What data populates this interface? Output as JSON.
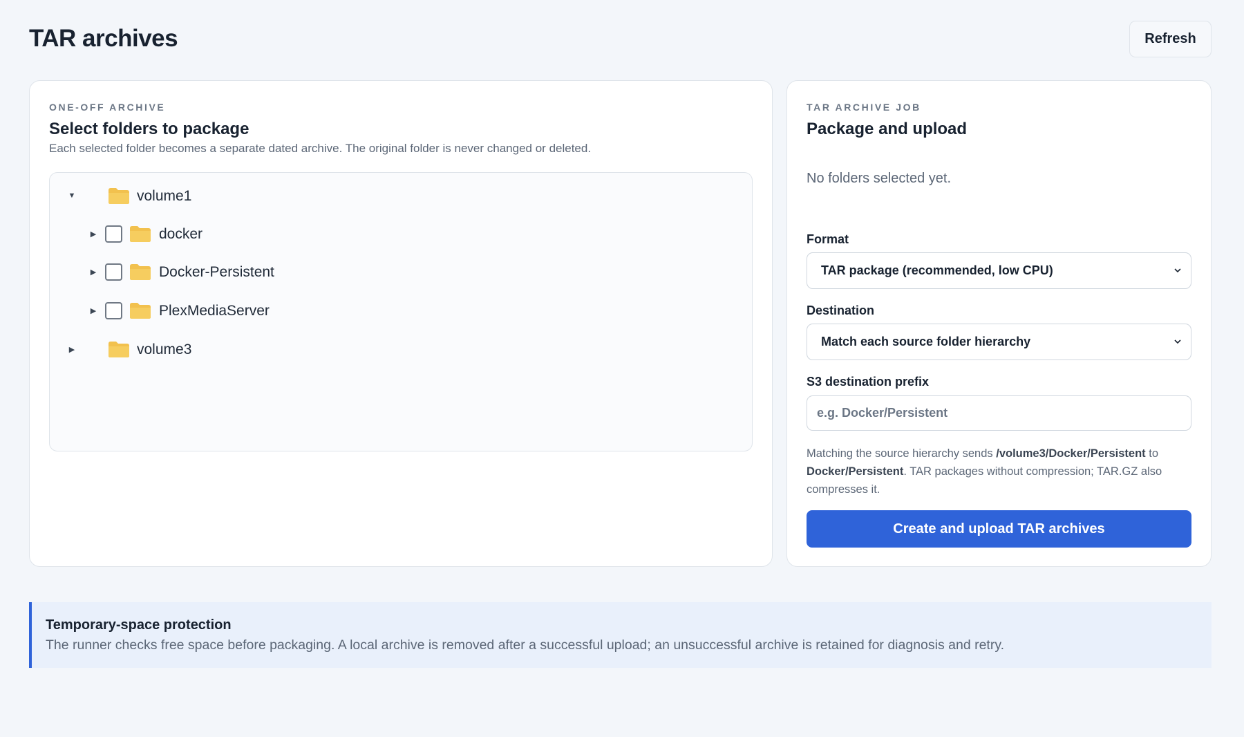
{
  "header": {
    "title": "TAR archives",
    "refresh_label": "Refresh"
  },
  "left_card": {
    "eyebrow": "ONE-OFF ARCHIVE",
    "title": "Select folders to package",
    "description": "Each selected folder becomes a separate dated archive. The original folder is never changed or deleted.",
    "tree": [
      {
        "label": "volume1",
        "expanded": true,
        "selectable": false
      },
      {
        "label": "docker",
        "expanded": false,
        "selectable": true,
        "checked": false
      },
      {
        "label": "Docker-Persistent",
        "expanded": false,
        "selectable": true,
        "checked": false
      },
      {
        "label": "PlexMediaServer",
        "expanded": false,
        "selectable": true,
        "checked": false
      },
      {
        "label": "volume3",
        "expanded": false,
        "selectable": false
      }
    ]
  },
  "right_card": {
    "eyebrow": "TAR ARCHIVE JOB",
    "title": "Package and upload",
    "empty_message": "No folders selected yet.",
    "format_label": "Format",
    "format_value": "TAR package (recommended, low CPU)",
    "destination_label": "Destination",
    "destination_value": "Match each source folder hierarchy",
    "prefix_label": "S3 destination prefix",
    "prefix_placeholder": "e.g. Docker/Persistent",
    "help_prefix": "Matching the source hierarchy sends ",
    "help_source": "/volume3/Docker/Persistent",
    "help_to": " to ",
    "help_dest": "Docker/Persistent",
    "help_suffix": ". TAR packages without compression; TAR.GZ also compresses it.",
    "submit_label": "Create and upload TAR archives"
  },
  "notice": {
    "title": "Temporary-space protection",
    "body": "The runner checks free space before packaging. A local archive is removed after a successful upload; an unsuccessful archive is retained for diagnosis and retry."
  },
  "colors": {
    "accent": "#2f63d9",
    "folder": "#f2c14e",
    "background": "#f3f6fa"
  }
}
